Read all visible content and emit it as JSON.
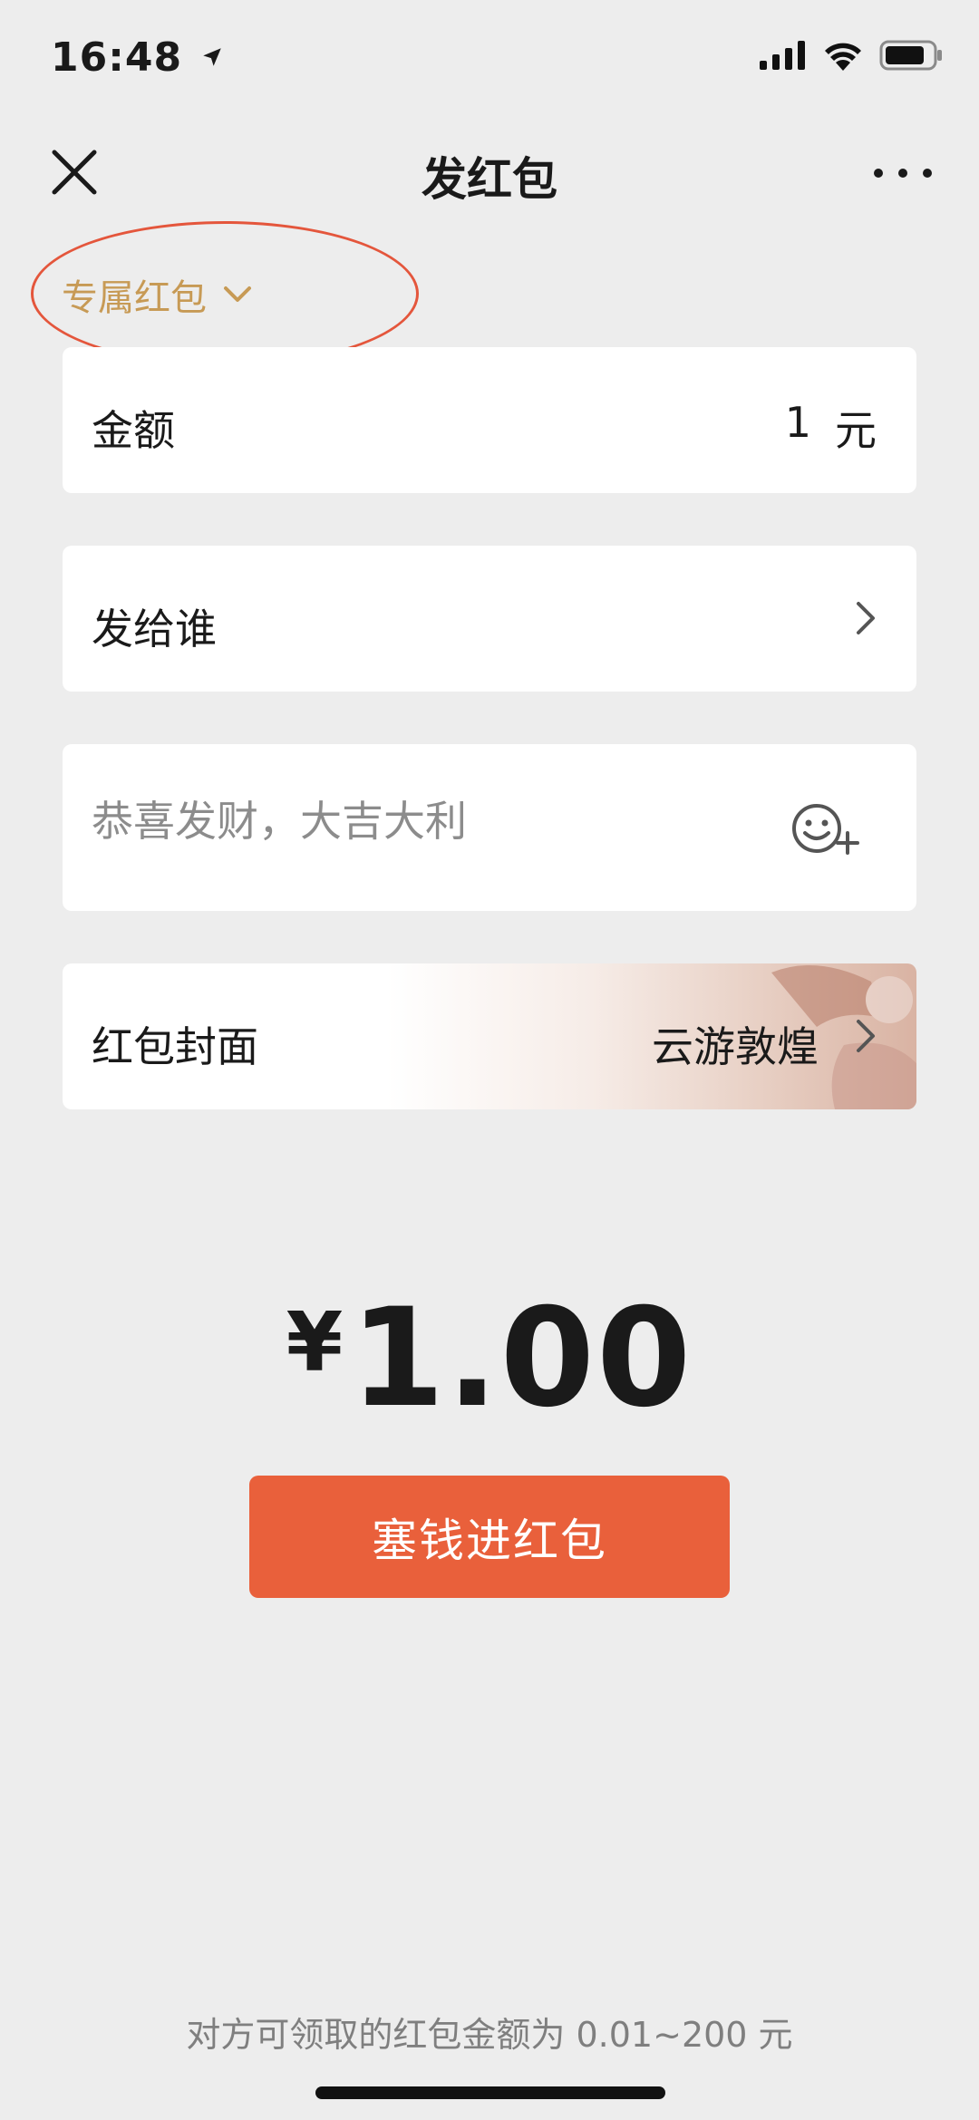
{
  "status_bar": {
    "time": "16:48"
  },
  "header": {
    "title": "发红包"
  },
  "type_selector": {
    "label": "专属红包"
  },
  "amount_row": {
    "label": "金额",
    "value": "1",
    "unit": "元"
  },
  "recipient_row": {
    "label": "发给谁"
  },
  "message_row": {
    "placeholder": "恭喜发财，大吉大利"
  },
  "cover_row": {
    "label": "红包封面",
    "value": "云游敦煌"
  },
  "total": {
    "currency": "¥",
    "amount": "1.00"
  },
  "submit": {
    "label": "塞钱进红包"
  },
  "footer": {
    "note": "对方可领取的红包金额为 0.01~200 元"
  },
  "colors": {
    "accent_gold": "#c79a55",
    "primary_button": "#e9603b",
    "annotation_circle": "#e4563c",
    "background": "#ededed"
  }
}
